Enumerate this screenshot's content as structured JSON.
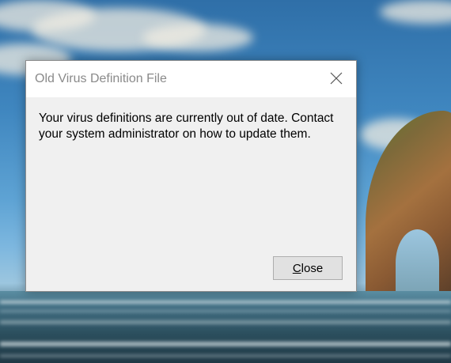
{
  "desktop": {
    "wallpaper": "beach-arch-landscape"
  },
  "dialog": {
    "title": "Old Virus Definition File",
    "close_icon": "close-x-icon",
    "message_line1": "Your virus definitions are currently out of date. Contact",
    "message_line2": "your system administrator on how to update them.",
    "button": {
      "mnemonic": "C",
      "rest": "lose"
    }
  },
  "colors": {
    "title_text": "#8a8a8a",
    "dialog_bg": "#f0f0f0",
    "titlebar_bg": "#ffffff",
    "button_bg": "#e1e1e1",
    "button_border": "#adadad"
  }
}
